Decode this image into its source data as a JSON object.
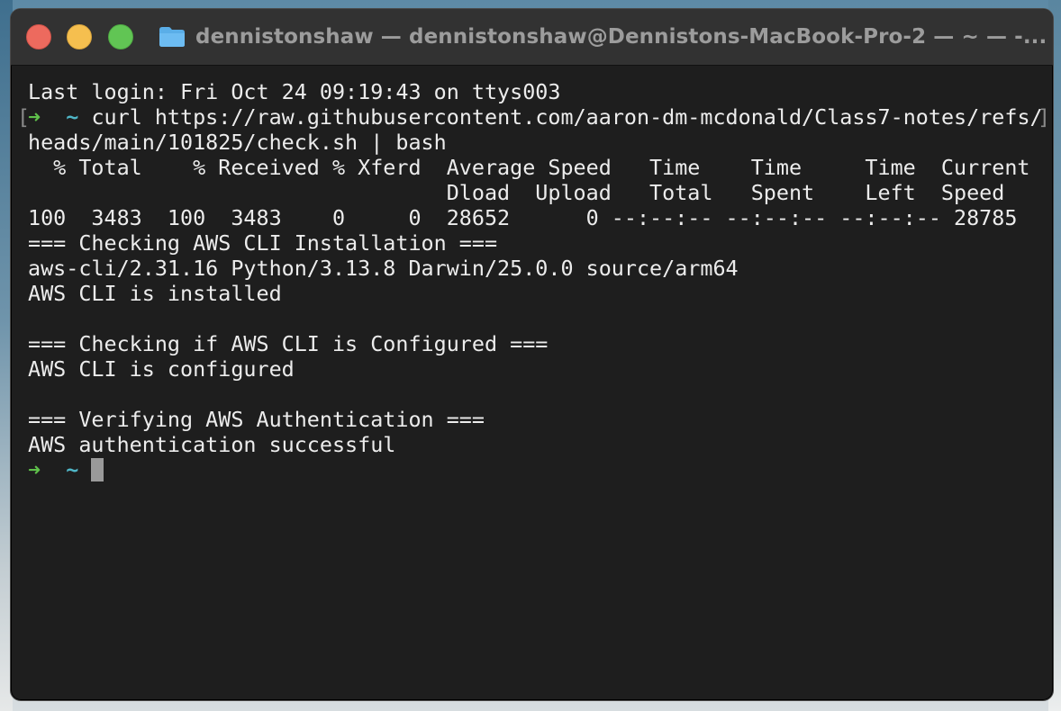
{
  "window": {
    "title": "dennistonshaw — dennistonshaw@Dennistons-MacBook-Pro-2 — ~ — -..."
  },
  "terminal": {
    "last_login": "Last login: Fri Oct 24 09:19:43 on ttys003",
    "prompt_arrow": "➜",
    "prompt_dir": "~",
    "command_part1": " curl https://raw.githubusercontent.com/aaron-dm-mcdonald/Class7-notes/refs/",
    "command_part2": "heads/main/101825/check.sh | bash",
    "curl_header1": "  % Total    % Received % Xferd  Average Speed   Time    Time     Time  Current",
    "curl_header2": "                                 Dload  Upload   Total   Spent    Left  Speed",
    "curl_progress": "100  3483  100  3483    0     0  28652      0 --:--:-- --:--:-- --:--:-- 28785",
    "section1_header": "=== Checking AWS CLI Installation ===",
    "cli_version": "aws-cli/2.31.16 Python/3.13.8 Darwin/25.0.0 source/arm64",
    "cli_installed": "AWS CLI is installed",
    "section2_header": "=== Checking if AWS CLI is Configured ===",
    "cli_configured": "AWS CLI is configured",
    "section3_header": "=== Verifying AWS Authentication ===",
    "auth_result": "AWS authentication successful",
    "wrap_bracket_left": "[",
    "wrap_bracket_right": "]"
  },
  "colors": {
    "prompt_arrow": "#5fc04b",
    "prompt_dir": "#4fb6c7",
    "close": "#ed6a5e",
    "minimize": "#f5bf4f",
    "maximize": "#61c554"
  },
  "icons": {
    "title": "folder-icon"
  }
}
